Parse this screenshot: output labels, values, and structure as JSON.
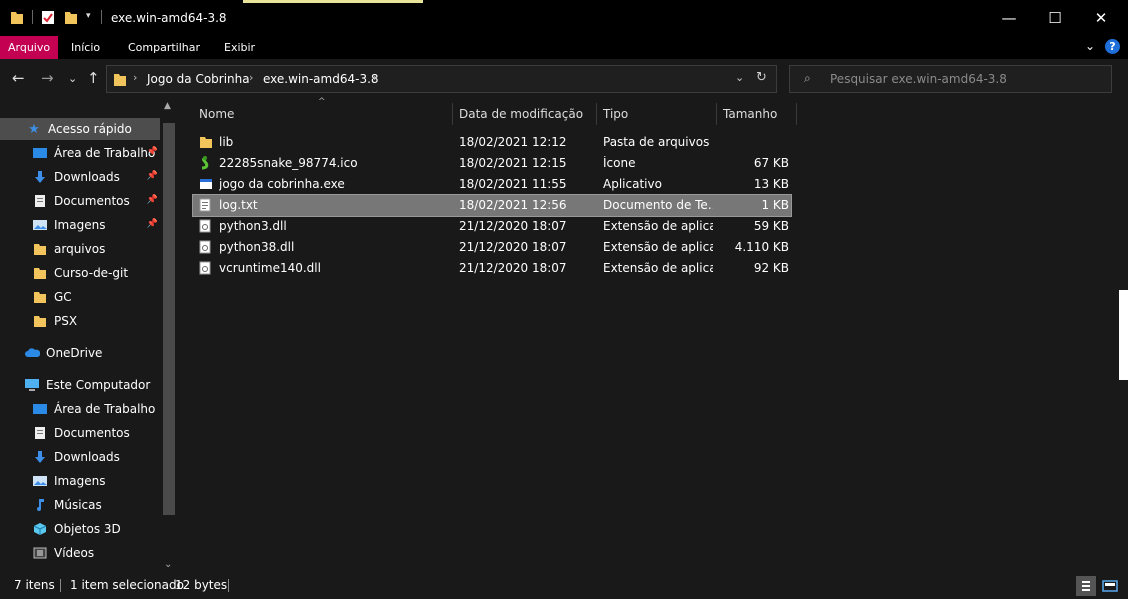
{
  "window": {
    "title": "exe.win-amd64-3.8",
    "minimize": "—",
    "maximize": "☐",
    "close": "✕"
  },
  "ribbon": {
    "tabs": [
      "Arquivo",
      "Início",
      "Compartilhar",
      "Exibir"
    ]
  },
  "breadcrumb": [
    "Jogo da Cobrinha",
    "exe.win-amd64-3.8"
  ],
  "search": {
    "placeholder": "Pesquisar exe.win-amd64-3.8"
  },
  "nav": {
    "quick_access": "Acesso rápido",
    "quick_items": [
      {
        "label": "Área de Trabalho",
        "icon": "desktop-icon",
        "pinned": true
      },
      {
        "label": "Downloads",
        "icon": "download-icon",
        "pinned": true
      },
      {
        "label": "Documentos",
        "icon": "documents-icon",
        "pinned": true
      },
      {
        "label": "Imagens",
        "icon": "images-icon",
        "pinned": true
      },
      {
        "label": "arquivos",
        "icon": "folder-icon",
        "pinned": false
      },
      {
        "label": "Curso-de-git",
        "icon": "folder-icon",
        "pinned": false
      },
      {
        "label": "GC",
        "icon": "folder-icon",
        "pinned": false
      },
      {
        "label": "PSX",
        "icon": "folder-icon",
        "pinned": false
      }
    ],
    "onedrive": "OneDrive",
    "this_pc": "Este Computador",
    "pc_items": [
      {
        "label": "Área de Trabalho",
        "icon": "desktop-icon"
      },
      {
        "label": "Documentos",
        "icon": "documents-icon"
      },
      {
        "label": "Downloads",
        "icon": "download-icon"
      },
      {
        "label": "Imagens",
        "icon": "images-icon"
      },
      {
        "label": "Músicas",
        "icon": "music-icon"
      },
      {
        "label": "Objetos 3D",
        "icon": "3d-objects-icon"
      },
      {
        "label": "Vídeos",
        "icon": "videos-icon"
      }
    ]
  },
  "columns": {
    "name": "Nome",
    "date": "Data de modificação",
    "type": "Tipo",
    "size": "Tamanho"
  },
  "files": [
    {
      "name": "lib",
      "date": "18/02/2021 12:12",
      "type": "Pasta de arquivos",
      "size": "",
      "icon": "folder-icon",
      "selected": false
    },
    {
      "name": "22285snake_98774.ico",
      "date": "18/02/2021 12:15",
      "type": "Ícone",
      "size": "67 KB",
      "icon": "snake-icon",
      "selected": false
    },
    {
      "name": "jogo da cobrinha.exe",
      "date": "18/02/2021 11:55",
      "type": "Aplicativo",
      "size": "13 KB",
      "icon": "exe-icon",
      "selected": false
    },
    {
      "name": "log.txt",
      "date": "18/02/2021 12:56",
      "type": "Documento de Te...",
      "size": "1 KB",
      "icon": "text-file-icon",
      "selected": true
    },
    {
      "name": "python3.dll",
      "date": "21/12/2020 18:07",
      "type": "Extensão de aplica...",
      "size": "59 KB",
      "icon": "dll-icon",
      "selected": false
    },
    {
      "name": "python38.dll",
      "date": "21/12/2020 18:07",
      "type": "Extensão de aplica...",
      "size": "4.110 KB",
      "icon": "dll-icon",
      "selected": false
    },
    {
      "name": "vcruntime140.dll",
      "date": "21/12/2020 18:07",
      "type": "Extensão de aplica...",
      "size": "92 KB",
      "icon": "dll-icon",
      "selected": false
    }
  ],
  "status": {
    "count": "7 itens",
    "selected": "1 item selecionado",
    "size": "12 bytes"
  },
  "colors": {
    "background": "#191919",
    "titlebar": "#000000",
    "file_tab": "#c30052",
    "selection": "#777777",
    "folder": "#f2c55c"
  }
}
